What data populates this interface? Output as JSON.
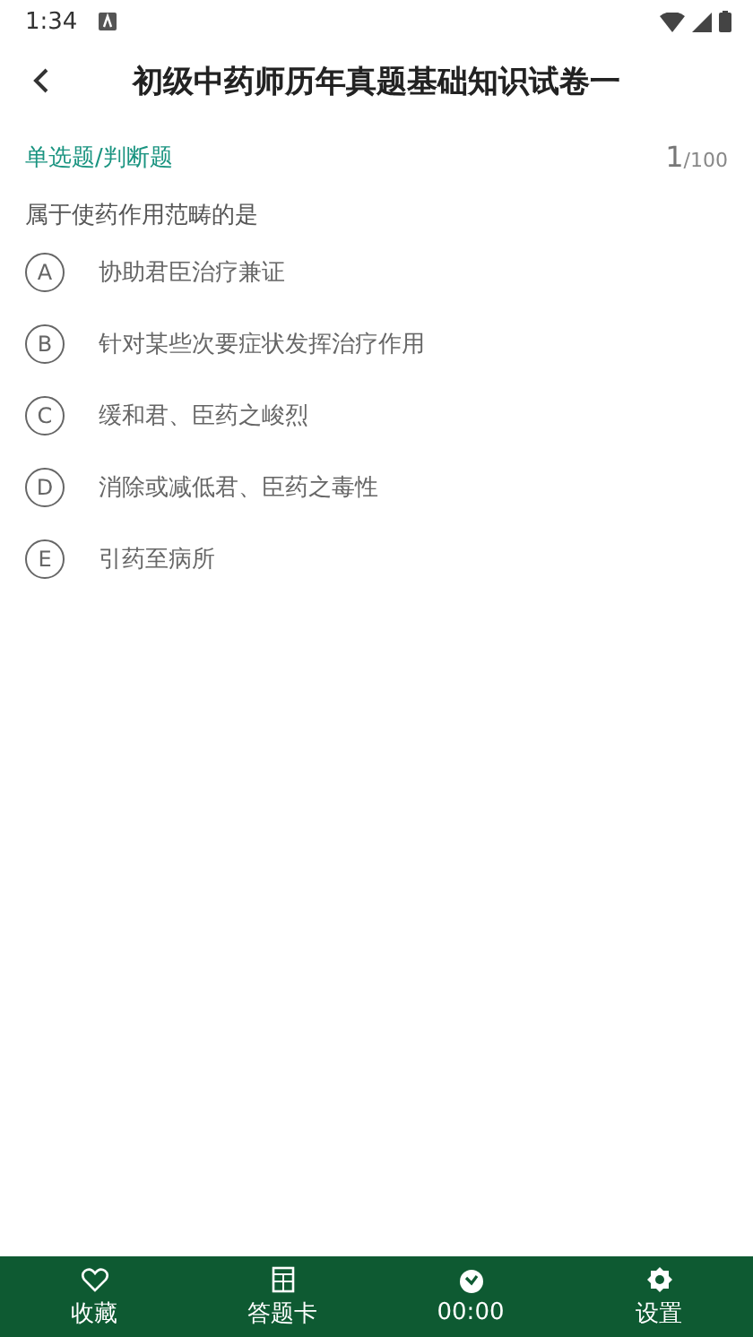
{
  "status_bar": {
    "time": "1:34"
  },
  "header": {
    "title": "初级中药师历年真题基础知识试卷一"
  },
  "question": {
    "type": "单选题/判断题",
    "number": "1",
    "total": "/100",
    "text": "属于使药作用范畴的是",
    "options": [
      {
        "letter": "A",
        "text": "协助君臣治疗兼证",
        "selected": false
      },
      {
        "letter": "B",
        "text": "针对某些次要症状发挥治疗作用",
        "selected": false
      },
      {
        "letter": "C",
        "text": "缓和君、臣药之峻烈",
        "selected": false
      },
      {
        "letter": "D",
        "text": "消除或减低君、臣药之毒性",
        "selected": false
      },
      {
        "letter": "E",
        "text": "引药至病所",
        "selected": false
      }
    ]
  },
  "bottom_bar": [
    {
      "kind": "favorite",
      "label": "收藏"
    },
    {
      "kind": "card",
      "label": "答题卡"
    },
    {
      "kind": "timer",
      "label": "00:00"
    },
    {
      "kind": "settings",
      "label": "设置"
    }
  ]
}
